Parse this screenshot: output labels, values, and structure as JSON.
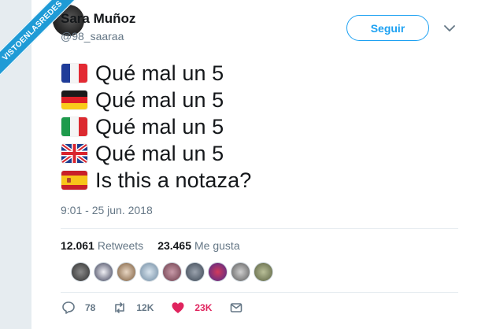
{
  "user": {
    "name": "Sara Muñoz",
    "handle": "@98_saaraa"
  },
  "follow_button": {
    "label": "Seguir"
  },
  "tweet": {
    "lines": [
      {
        "flag": "france-flag",
        "text": "Qué mal un 5"
      },
      {
        "flag": "germany-flag",
        "text": "Qué mal un 5"
      },
      {
        "flag": "italy-flag",
        "text": "Qué mal un 5"
      },
      {
        "flag": "uk-flag",
        "text": "Qué mal un 5"
      },
      {
        "flag": "spain-flag",
        "text": "Is this a notaza?"
      }
    ],
    "timestamp": "9:01 - 25 jun. 2018"
  },
  "stats": {
    "retweets_count": "12.061",
    "retweets_label": "Retweets",
    "likes_count": "23.465",
    "likes_label": "Me gusta"
  },
  "liker_avatars": 9,
  "actions": {
    "reply_count": "78",
    "retweet_count": "12K",
    "like_count": "23K"
  },
  "watermark": "VISTOENLASREDES",
  "colors": {
    "accent": "#1da1f2",
    "like": "#e0245e",
    "secondary_text": "#657786",
    "background": "#e6ecf0",
    "watermark": "#1f9bd6"
  }
}
